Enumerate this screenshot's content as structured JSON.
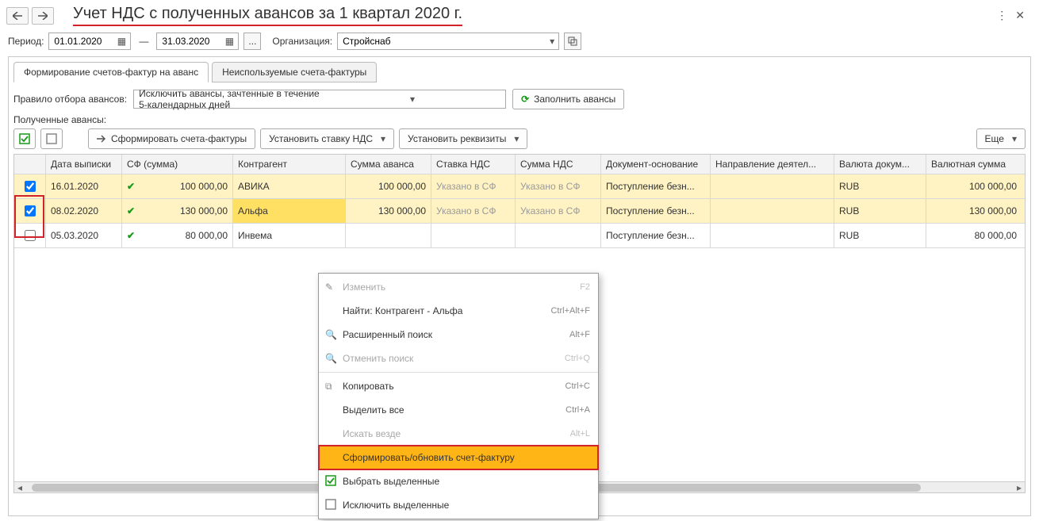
{
  "header": {
    "title": "Учет НДС с полученных авансов за 1 квартал 2020 г."
  },
  "filters": {
    "period_label": "Период:",
    "date_from": "01.01.2020",
    "date_to": "31.03.2020",
    "org_label": "Организация:",
    "org_value": "Стройснаб"
  },
  "tabs": {
    "t1": "Формирование счетов-фактур на аванс",
    "t2": "Неиспользуемые счета-фактуры"
  },
  "rule": {
    "label": "Правило отбора авансов:",
    "value": "Исключить авансы, зачтенные в течение 5-календарных дней",
    "fill_btn": "Заполнить авансы"
  },
  "section_label": "Полученные авансы:",
  "toolbar": {
    "form_btn": "Сформировать счета-фактуры",
    "rate_btn": "Установить ставку НДС",
    "req_btn": "Установить реквизиты",
    "more_btn": "Еще"
  },
  "columns": {
    "date": "Дата выписки",
    "sf": "СФ (сумма)",
    "contr": "Контрагент",
    "sum": "Сумма аванса",
    "rate": "Ставка НДС",
    "nds": "Сумма НДС",
    "doc": "Документ-основание",
    "dir": "Направление деятел...",
    "curr": "Валюта докум...",
    "csum": "Валютная сумма"
  },
  "rows": [
    {
      "chk": true,
      "date": "16.01.2020",
      "sf": "100 000,00",
      "contr": "АВИКА",
      "sum": "100 000,00",
      "rate": "Указано в СФ",
      "nds": "Указано в СФ",
      "doc": "Поступление безн...",
      "dir": "",
      "curr": "RUB",
      "csum": "100 000,00"
    },
    {
      "chk": true,
      "date": "08.02.2020",
      "sf": "130 000,00",
      "contr": "Альфа",
      "sum": "130 000,00",
      "rate": "Указано в СФ",
      "nds": "Указано в СФ",
      "doc": "Поступление безн...",
      "dir": "",
      "curr": "RUB",
      "csum": "130 000,00"
    },
    {
      "chk": false,
      "date": "05.03.2020",
      "sf": "80 000,00",
      "contr": "Инвема",
      "sum": "",
      "rate": "",
      "nds": "",
      "doc": "Поступление безн...",
      "dir": "",
      "curr": "RUB",
      "csum": "80 000,00"
    }
  ],
  "ctx": {
    "edit": "Изменить",
    "edit_sc": "F2",
    "find": "Найти: Контрагент - Альфа",
    "find_sc": "Ctrl+Alt+F",
    "adv": "Расширенный поиск",
    "adv_sc": "Alt+F",
    "cancel": "Отменить поиск",
    "cancel_sc": "Ctrl+Q",
    "copy": "Копировать",
    "copy_sc": "Ctrl+C",
    "selall": "Выделить все",
    "selall_sc": "Ctrl+A",
    "everywhere": "Искать везде",
    "everywhere_sc": "Alt+L",
    "form": "Сформировать/обновить счет-фактуру",
    "pick": "Выбрать выделенные",
    "excl": "Исключить выделенные"
  }
}
